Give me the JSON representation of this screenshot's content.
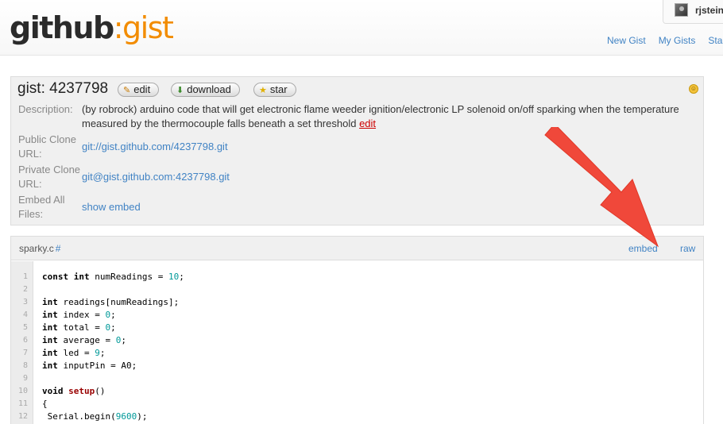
{
  "header": {
    "logo_main": "github",
    "logo_sep": ":",
    "logo_sub": "gist",
    "username": "rjstein",
    "nav": [
      "New Gist",
      "My Gists",
      "Star"
    ]
  },
  "gist": {
    "title": "gist: 4237798",
    "buttons": {
      "edit": "edit",
      "download": "download",
      "star": "star"
    },
    "description_label": "Description:",
    "description": "(by robrock) arduino code that will get electronic flame weeder ignition/electronic LP solenoid on/off sparking when the temperature measured by the thermocouple falls beneath a set threshold",
    "description_edit": "edit",
    "public_clone_label": "Public Clone URL:",
    "public_clone_url": "git://gist.github.com/4237798.git",
    "private_clone_label": "Private Clone URL:",
    "private_clone_url": "git@gist.github.com:4237798.git",
    "embed_all_label": "Embed All Files:",
    "embed_all_link": "show embed"
  },
  "file": {
    "name": "sparky.c",
    "hash": "#",
    "embed_label": "embed",
    "raw_label": "raw",
    "lines": [
      {
        "n": "1",
        "tokens": [
          [
            "kw",
            "const"
          ],
          [
            "t",
            " "
          ],
          [
            "kw",
            "int"
          ],
          [
            "t",
            " numReadings = "
          ],
          [
            "num",
            "10"
          ],
          [
            "t",
            ";"
          ]
        ]
      },
      {
        "n": "2",
        "tokens": []
      },
      {
        "n": "3",
        "tokens": [
          [
            "kw",
            "int"
          ],
          [
            "t",
            " readings[numReadings];"
          ]
        ]
      },
      {
        "n": "4",
        "tokens": [
          [
            "kw",
            "int"
          ],
          [
            "t",
            " index = "
          ],
          [
            "num",
            "0"
          ],
          [
            "t",
            ";"
          ]
        ]
      },
      {
        "n": "5",
        "tokens": [
          [
            "kw",
            "int"
          ],
          [
            "t",
            " total = "
          ],
          [
            "num",
            "0"
          ],
          [
            "t",
            ";"
          ]
        ]
      },
      {
        "n": "6",
        "tokens": [
          [
            "kw",
            "int"
          ],
          [
            "t",
            " average = "
          ],
          [
            "num",
            "0"
          ],
          [
            "t",
            ";"
          ]
        ]
      },
      {
        "n": "7",
        "tokens": [
          [
            "kw",
            "int"
          ],
          [
            "t",
            " led = "
          ],
          [
            "num",
            "9"
          ],
          [
            "t",
            ";"
          ]
        ]
      },
      {
        "n": "8",
        "tokens": [
          [
            "kw",
            "int"
          ],
          [
            "t",
            " inputPin = A0;"
          ]
        ]
      },
      {
        "n": "9",
        "tokens": []
      },
      {
        "n": "10",
        "tokens": [
          [
            "kw",
            "void"
          ],
          [
            "t",
            " "
          ],
          [
            "fn",
            "setup"
          ],
          [
            "t",
            "()"
          ]
        ]
      },
      {
        "n": "11",
        "tokens": [
          [
            "t",
            "{"
          ]
        ]
      },
      {
        "n": "12",
        "tokens": [
          [
            "t",
            " Serial.begin("
          ],
          [
            "num",
            "9600"
          ],
          [
            "t",
            ");"
          ]
        ]
      }
    ]
  },
  "colors": {
    "link": "#4183c4",
    "logo_accent": "#f28c00",
    "arrow": "#f0483a"
  },
  "icons": [
    "pencil-icon",
    "download-arrow-icon",
    "star-icon",
    "smiley-icon",
    "avatar"
  ]
}
